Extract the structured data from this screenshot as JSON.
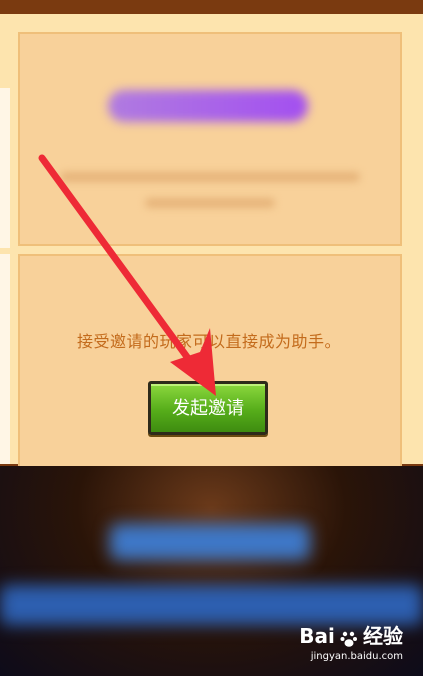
{
  "dialog": {
    "description": "接受邀请的玩家可以直接成为助手。",
    "invite_button_label": "发起邀请"
  },
  "watermark": {
    "brand": "Bai",
    "brand_suffix": "经验",
    "url": "jingyan.baidu.com"
  },
  "colors": {
    "panel": "#fde4ae",
    "card": "#f8d19a",
    "text": "#c36b1c",
    "button": "#56ad1a",
    "arrow": "#ee2a36"
  }
}
